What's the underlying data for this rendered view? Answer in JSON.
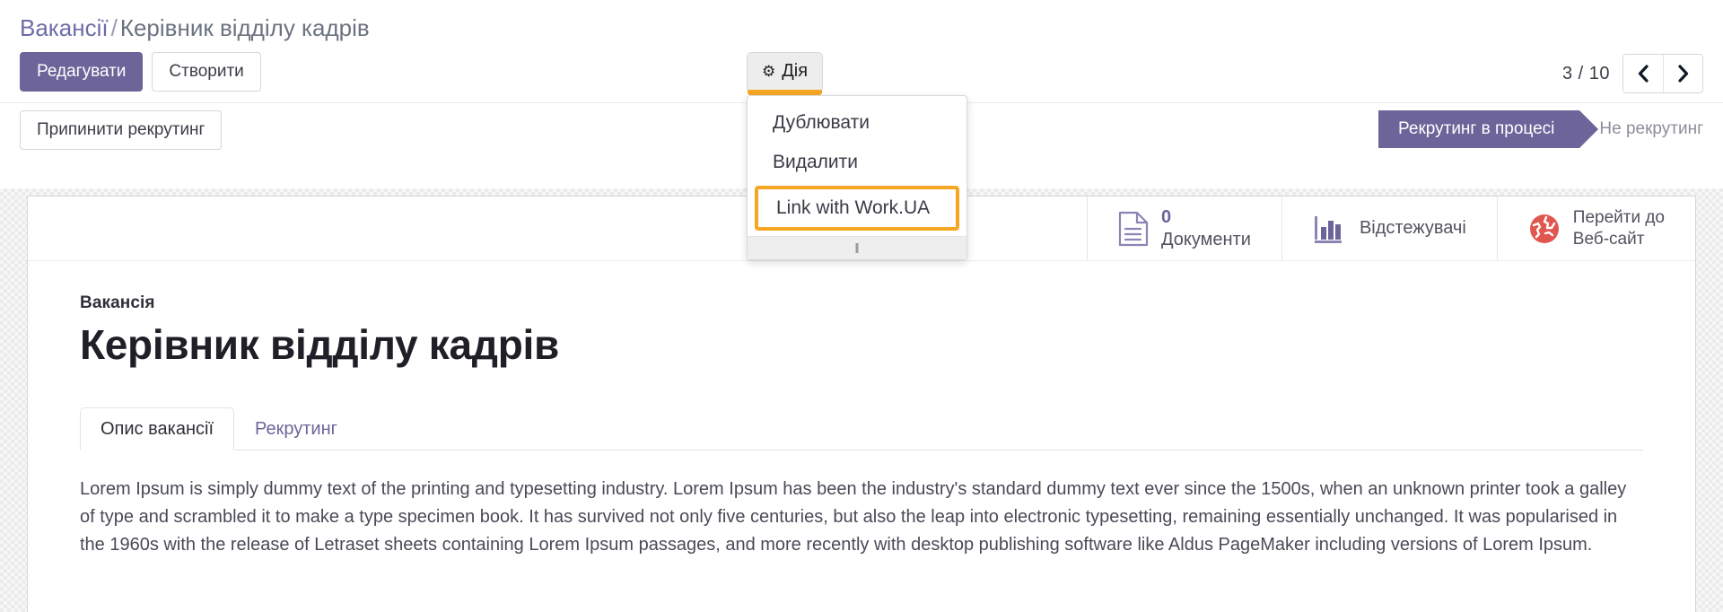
{
  "breadcrumb": {
    "root": "Вакансії",
    "separator": "/",
    "current": "Керівник відділу кадрів"
  },
  "toolbar": {
    "edit_label": "Редагувати",
    "create_label": "Створити",
    "action_label": "Дія",
    "action_icon": "gear-icon"
  },
  "action_menu": {
    "items": [
      {
        "label": "Дублювати",
        "highlighted": false
      },
      {
        "label": "Видалити",
        "highlighted": false
      },
      {
        "label": "Link with Work.UA",
        "highlighted": true
      }
    ]
  },
  "pager": {
    "count": "3 / 10",
    "prev_icon": "chevron-left-icon",
    "next_icon": "chevron-right-icon"
  },
  "status_actions": {
    "stop_recruitment_label": "Припинити рекрутинг"
  },
  "statusbar": {
    "stages": [
      {
        "label": "Рекрутинг в процесі",
        "active": true
      },
      {
        "label": "Не рекрутинг",
        "active": false
      }
    ]
  },
  "smart_buttons": [
    {
      "icon": "document-icon",
      "value": "0",
      "label": "Документи"
    },
    {
      "icon": "bar-chart-icon",
      "value": "",
      "label": "Відстежувачі"
    },
    {
      "icon": "globe-icon",
      "value": "",
      "label": "Перейти до",
      "label2": "Веб-сайт"
    }
  ],
  "record": {
    "subtitle": "Вакансія",
    "title": "Керівник відділу кадрів"
  },
  "notebook": {
    "tabs": [
      {
        "label": "Опис вакансії",
        "active": true
      },
      {
        "label": "Рекрутинг",
        "active": false
      }
    ],
    "content": "Lorem Ipsum is simply dummy text of the printing and typesetting industry. Lorem Ipsum has been the industry's standard dummy text ever since the 1500s, when an unknown printer took a galley of type and scrambled it to make a type specimen book. It has survived not only five centuries, but also the leap into electronic typesetting, remaining essentially unchanged. It was popularised in the 1960s with the release of Letraset sheets containing Lorem Ipsum passages, and more recently with desktop publishing software like Aldus PageMaker including versions of Lorem Ipsum."
  },
  "colors": {
    "brand_purple": "#6d6499",
    "highlight_orange": "#f5a623",
    "globe_red": "#e1564f",
    "link_purple": "#6c6ca8"
  }
}
